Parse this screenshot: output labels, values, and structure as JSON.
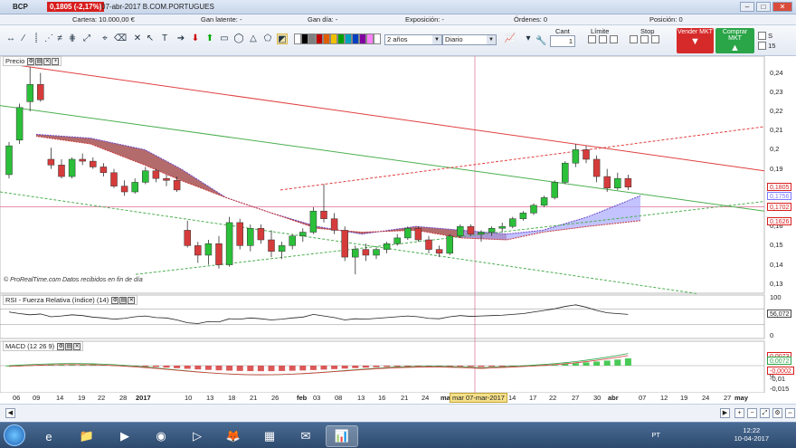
{
  "titlebar": {
    "symbol": "BCP",
    "change": "0,1805 (-2,17%)",
    "title": "07-abr-2017 B.COM.PORTUGUES"
  },
  "account": {
    "cartera": "Cartera: 10.000,00 €",
    "ganancia": "Gan latente: -",
    "ganDia": "Gan día: -",
    "exposicion": "Exposición: -",
    "ordenes": "Órdenes: 0",
    "posicion": "Posición: 0"
  },
  "toolbar": {
    "period": "2 años",
    "interval": "Diario",
    "swatches": [
      "#ffffff",
      "#000000",
      "#7f7f7f",
      "#c00000",
      "#e06000",
      "#f0c000",
      "#00a000",
      "#00a0c0",
      "#0040c0",
      "#8000a0",
      "#ff80ff",
      "#ffffff"
    ]
  },
  "order": {
    "cant_label": "Cant",
    "cant_value": "1",
    "limite_label": "Límite",
    "stop_label": "Stop",
    "sell_label": "Vender MKT",
    "buy_label": "Comprar MKT",
    "s_label": "S",
    "s_value": "15"
  },
  "price_panel": {
    "label": "Precio",
    "copyright": "© ProRealTime.com  Datos recibidos en fin de día",
    "tags": [
      {
        "text": "0,1805",
        "color": "#d81e1e"
      },
      {
        "text": "0,1756",
        "color": "#7a7aff"
      },
      {
        "text": "0,1702",
        "color": "#d81e1e"
      },
      {
        "text": "0,1626",
        "color": "#d81e1e"
      }
    ],
    "ylabels": [
      "0,24",
      "0,23",
      "0,22",
      "0,21",
      "0,2",
      "0,19",
      "0,18",
      "0,17",
      "0,16",
      "0,15",
      "0,14",
      "0,13"
    ],
    "candles": [
      [
        0.187,
        0.204,
        0.185,
        0.202
      ],
      [
        0.205,
        0.224,
        0.203,
        0.222
      ],
      [
        0.225,
        0.243,
        0.22,
        0.234
      ],
      [
        0.234,
        0.24,
        0.225,
        0.226
      ],
      [
        0.195,
        0.201,
        0.19,
        0.192
      ],
      [
        0.192,
        0.195,
        0.185,
        0.186
      ],
      [
        0.186,
        0.196,
        0.185,
        0.195
      ],
      [
        0.195,
        0.198,
        0.192,
        0.194
      ],
      [
        0.194,
        0.196,
        0.19,
        0.191
      ],
      [
        0.191,
        0.193,
        0.186,
        0.188
      ],
      [
        0.188,
        0.19,
        0.18,
        0.181
      ],
      [
        0.181,
        0.184,
        0.176,
        0.178
      ],
      [
        0.178,
        0.185,
        0.177,
        0.183
      ],
      [
        0.183,
        0.191,
        0.182,
        0.189
      ],
      [
        0.189,
        0.19,
        0.183,
        0.185
      ],
      [
        0.185,
        0.187,
        0.181,
        0.184
      ],
      [
        0.184,
        0.186,
        0.178,
        0.179
      ],
      [
        0.158,
        0.163,
        0.149,
        0.15
      ],
      [
        0.15,
        0.152,
        0.141,
        0.145
      ],
      [
        0.145,
        0.153,
        0.14,
        0.151
      ],
      [
        0.151,
        0.155,
        0.138,
        0.14
      ],
      [
        0.14,
        0.165,
        0.139,
        0.162
      ],
      [
        0.162,
        0.164,
        0.148,
        0.15
      ],
      [
        0.15,
        0.161,
        0.147,
        0.159
      ],
      [
        0.159,
        0.161,
        0.151,
        0.153
      ],
      [
        0.153,
        0.158,
        0.144,
        0.147
      ],
      [
        0.147,
        0.152,
        0.143,
        0.15
      ],
      [
        0.15,
        0.156,
        0.148,
        0.155
      ],
      [
        0.155,
        0.159,
        0.152,
        0.157
      ],
      [
        0.157,
        0.17,
        0.156,
        0.168
      ],
      [
        0.168,
        0.182,
        0.162,
        0.164
      ],
      [
        0.164,
        0.167,
        0.156,
        0.158
      ],
      [
        0.158,
        0.16,
        0.142,
        0.144
      ],
      [
        0.144,
        0.15,
        0.135,
        0.148
      ],
      [
        0.148,
        0.151,
        0.142,
        0.145
      ],
      [
        0.145,
        0.149,
        0.143,
        0.148
      ],
      [
        0.148,
        0.152,
        0.146,
        0.151
      ],
      [
        0.151,
        0.156,
        0.15,
        0.154
      ],
      [
        0.154,
        0.16,
        0.153,
        0.159
      ],
      [
        0.159,
        0.16,
        0.152,
        0.153
      ],
      [
        0.153,
        0.155,
        0.146,
        0.148
      ],
      [
        0.148,
        0.15,
        0.144,
        0.146
      ],
      [
        0.146,
        0.156,
        0.145,
        0.155
      ],
      [
        0.155,
        0.161,
        0.154,
        0.16
      ],
      [
        0.16,
        0.161,
        0.155,
        0.156
      ],
      [
        0.156,
        0.158,
        0.152,
        0.157
      ],
      [
        0.157,
        0.16,
        0.155,
        0.159
      ],
      [
        0.159,
        0.162,
        0.157,
        0.16
      ],
      [
        0.16,
        0.165,
        0.159,
        0.164
      ],
      [
        0.164,
        0.168,
        0.163,
        0.167
      ],
      [
        0.167,
        0.172,
        0.166,
        0.171
      ],
      [
        0.171,
        0.176,
        0.17,
        0.175
      ],
      [
        0.175,
        0.184,
        0.174,
        0.183
      ],
      [
        0.183,
        0.194,
        0.182,
        0.193
      ],
      [
        0.193,
        0.203,
        0.191,
        0.2
      ],
      [
        0.2,
        0.202,
        0.193,
        0.195
      ],
      [
        0.195,
        0.197,
        0.183,
        0.186
      ],
      [
        0.186,
        0.19,
        0.178,
        0.18
      ],
      [
        0.18,
        0.188,
        0.179,
        0.185
      ],
      [
        0.185,
        0.187,
        0.179,
        0.1805
      ]
    ]
  },
  "rsi_panel": {
    "label": "RSI - Fuerza Relativa (índice) (14)",
    "value_tag": "56,072",
    "ylabels": [
      "100",
      "0"
    ]
  },
  "macd_panel": {
    "label": "MACD (12 26 9)",
    "tags": [
      {
        "text": "0,0073",
        "color": "#d81e1e"
      },
      {
        "text": "0,0072",
        "color": "#2aa548"
      },
      {
        "text": "-0,0002",
        "color": "#d81e1e"
      }
    ],
    "ylabels": [
      "0",
      "-0,01",
      "-0,015"
    ]
  },
  "crosshair": {
    "label": "mar 07-mar-2017"
  },
  "xaxis": {
    "labels": [
      "06",
      "09",
      "14",
      "19",
      "22",
      "28",
      "2017",
      "10",
      "13",
      "18",
      "21",
      "26",
      "feb",
      "03",
      "08",
      "13",
      "16",
      "21",
      "24",
      "mar",
      "14",
      "17",
      "22",
      "27",
      "30",
      "abr",
      "07",
      "12",
      "19",
      "24",
      "27",
      "may"
    ]
  },
  "taskbar": {
    "lang": "PT",
    "time": "12:22",
    "date": "10-04-2017"
  }
}
